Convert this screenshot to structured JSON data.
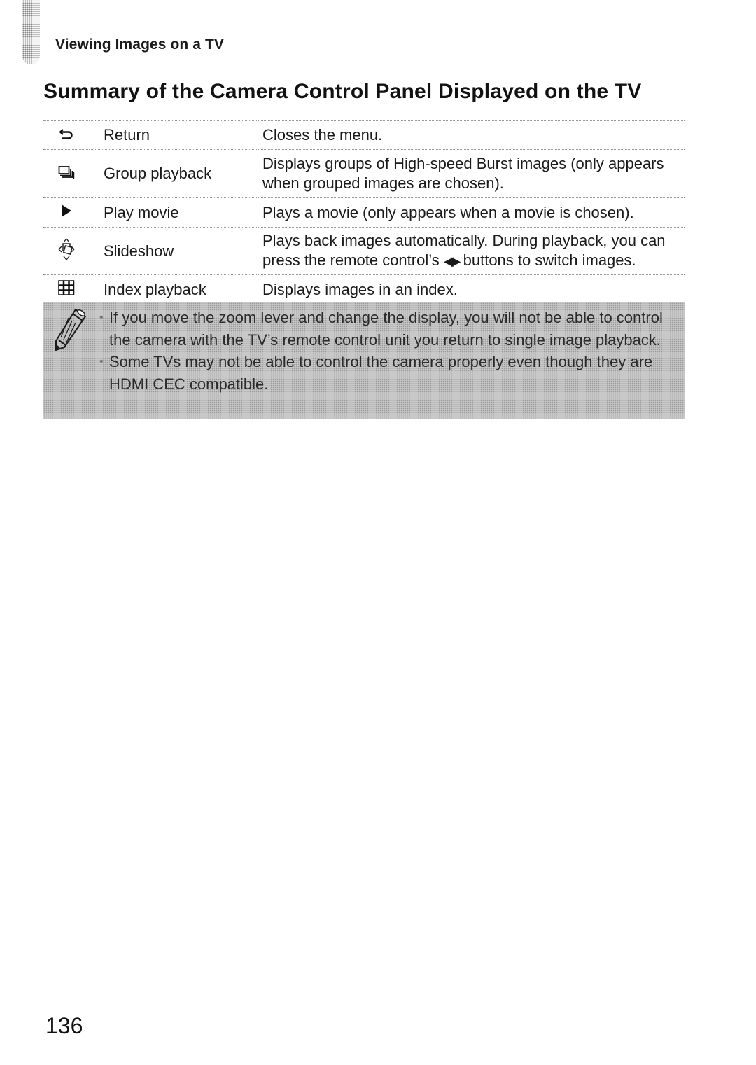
{
  "header": {
    "section": "Viewing Images on a TV"
  },
  "page_title": "Summary of the Camera Control Panel Displayed on the TV",
  "table": {
    "rows": [
      {
        "icon": "return-icon",
        "label": "Return",
        "description": "Closes the menu."
      },
      {
        "icon": "group-playback-icon",
        "label": "Group playback",
        "description": "Displays groups of High-speed Burst images (only appears when grouped images are chosen)."
      },
      {
        "icon": "play-icon",
        "label": "Play movie",
        "description": "Plays a movie (only appears when a movie is chosen)."
      },
      {
        "icon": "slideshow-icon",
        "label": "Slideshow",
        "description_before": "Plays back images automatically. During playback, you can press the remote control’s ",
        "description_arrows": "◀▶",
        "description_after": " buttons to switch images."
      },
      {
        "icon": "index-playback-icon",
        "label": "Index playback",
        "description": "Displays images in an index."
      }
    ]
  },
  "note": {
    "icon": "pencil-icon",
    "items": [
      "If you move the zoom lever and change the display, you will not be able to control the camera with the TV’s remote control unit you return to single image playback.",
      "Some TVs may not be able to control the camera properly even though they are HDMI CEC compatible."
    ]
  },
  "page_number": "136"
}
